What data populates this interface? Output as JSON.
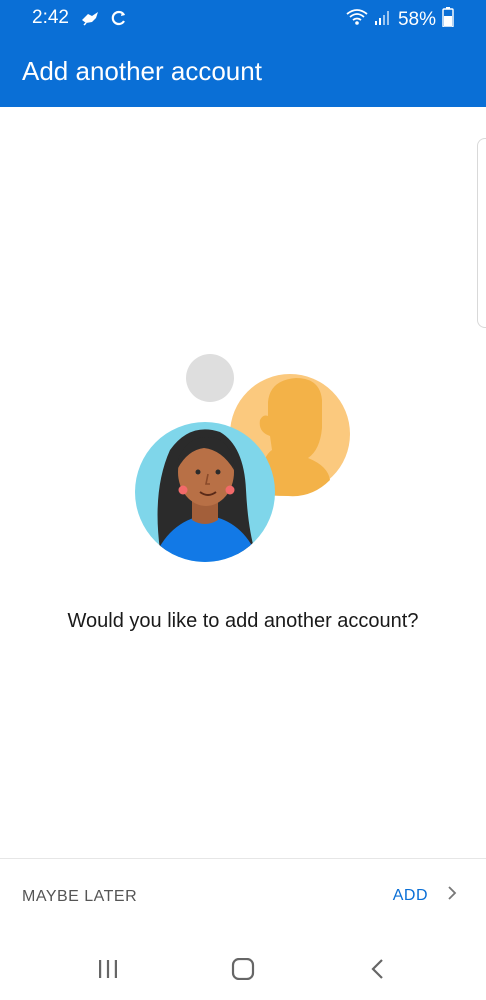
{
  "status_bar": {
    "time": "2:42",
    "battery": "58%",
    "icons": [
      "notification-bird-icon",
      "sync-icon",
      "wifi-icon",
      "signal-icon",
      "battery-icon"
    ]
  },
  "header": {
    "title": "Add another account",
    "color": "#0a6fd6"
  },
  "main": {
    "prompt": "Would you like to add another account?"
  },
  "footer": {
    "maybe_later": "MAYBE LATER",
    "add": "ADD"
  },
  "nav_bar": {
    "buttons": [
      "recent-apps-icon",
      "home-icon",
      "back-icon"
    ]
  }
}
